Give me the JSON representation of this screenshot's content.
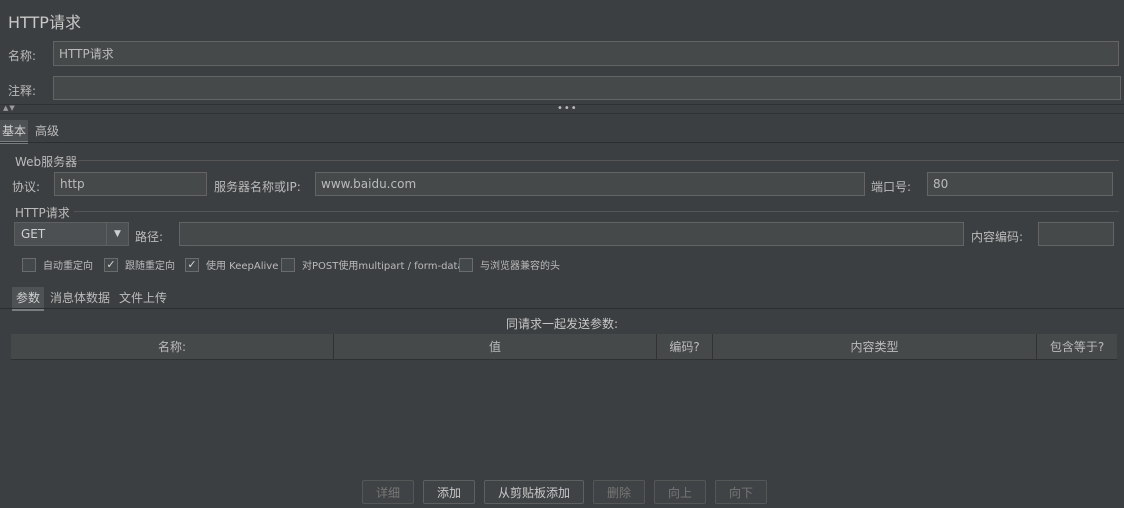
{
  "header": {
    "title": "HTTP请求"
  },
  "name_row": {
    "label": "名称:",
    "value": "HTTP请求"
  },
  "comment_row": {
    "label": "注释:",
    "value": ""
  },
  "tabs": [
    {
      "label": "基本",
      "active": true
    },
    {
      "label": "高级",
      "active": false
    }
  ],
  "web_server": {
    "title": "Web服务器",
    "protocol_label": "协议:",
    "protocol_value": "http",
    "server_label": "服务器名称或IP:",
    "server_value": "www.baidu.com",
    "port_label": "端口号:",
    "port_value": "80"
  },
  "http_request": {
    "title": "HTTP请求",
    "method": "GET",
    "path_label": "路径:",
    "path_value": "",
    "encoding_label": "内容编码:",
    "encoding_value": ""
  },
  "checkboxes": [
    {
      "label": "自动重定向",
      "checked": false
    },
    {
      "label": "跟随重定向",
      "checked": true
    },
    {
      "label": "使用 KeepAlive",
      "checked": true
    },
    {
      "label": "对POST使用multipart / form-data",
      "checked": false
    },
    {
      "label": "与浏览器兼容的头",
      "checked": false
    }
  ],
  "sub_tabs": [
    {
      "label": "参数",
      "active": true
    },
    {
      "label": "消息体数据",
      "active": false
    },
    {
      "label": "文件上传",
      "active": false
    }
  ],
  "params": {
    "caption": "同请求一起发送参数:",
    "columns": [
      "名称:",
      "值",
      "编码?",
      "内容类型",
      "包含等于?"
    ],
    "rows": []
  },
  "buttons": [
    {
      "label": "详细",
      "enabled": false
    },
    {
      "label": "添加",
      "enabled": true
    },
    {
      "label": "从剪贴板添加",
      "enabled": true
    },
    {
      "label": "删除",
      "enabled": false
    },
    {
      "label": "向上",
      "enabled": false
    },
    {
      "label": "向下",
      "enabled": false
    }
  ],
  "colors": {
    "background": "#3c3f41",
    "field": "#45494a",
    "text": "#bbbbbb"
  }
}
